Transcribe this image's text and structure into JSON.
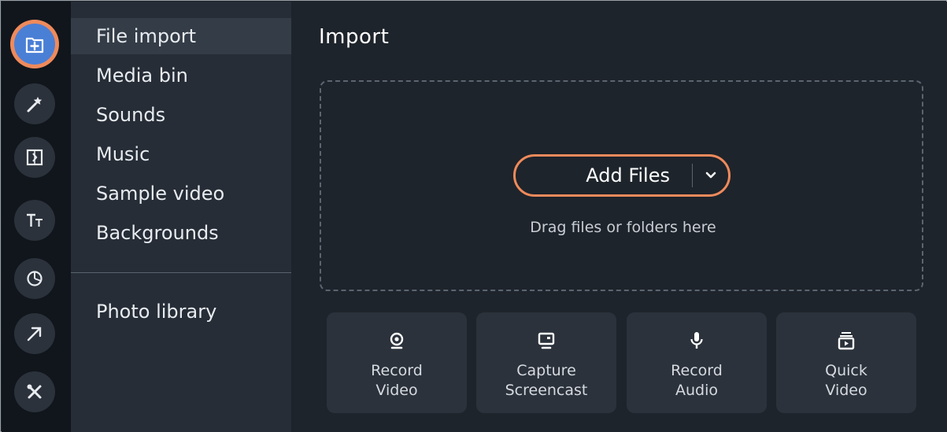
{
  "rail": {
    "items": [
      {
        "icon": "import-icon",
        "active": true
      },
      {
        "icon": "magic-wand-icon",
        "active": false
      },
      {
        "icon": "transitions-icon",
        "active": false
      },
      {
        "icon": "titles-icon",
        "active": false
      },
      {
        "icon": "stickers-icon",
        "active": false
      },
      {
        "icon": "callouts-arrow-icon",
        "active": false
      },
      {
        "icon": "tools-icon",
        "active": false
      }
    ],
    "active_color": "#4a7fd6",
    "highlight_color": "#ef8a5b"
  },
  "categories": {
    "items": [
      {
        "label": "File import",
        "selected": true
      },
      {
        "label": "Media bin",
        "selected": false
      },
      {
        "label": "Sounds",
        "selected": false
      },
      {
        "label": "Music",
        "selected": false
      },
      {
        "label": "Sample video",
        "selected": false
      },
      {
        "label": "Backgrounds",
        "selected": false
      }
    ],
    "library": {
      "label": "Photo library"
    }
  },
  "main": {
    "title": "Import",
    "add_files": {
      "label": "Add Files",
      "icon": "chevron-down-icon"
    },
    "drag_hint": "Drag files or folders here",
    "tiles": [
      {
        "label": "Record\nVideo",
        "icon": "webcam-icon"
      },
      {
        "label": "Capture\nScreencast",
        "icon": "monitor-icon"
      },
      {
        "label": "Record\nAudio",
        "icon": "microphone-icon"
      },
      {
        "label": "Quick\nVideo",
        "icon": "quick-video-icon"
      }
    ]
  }
}
